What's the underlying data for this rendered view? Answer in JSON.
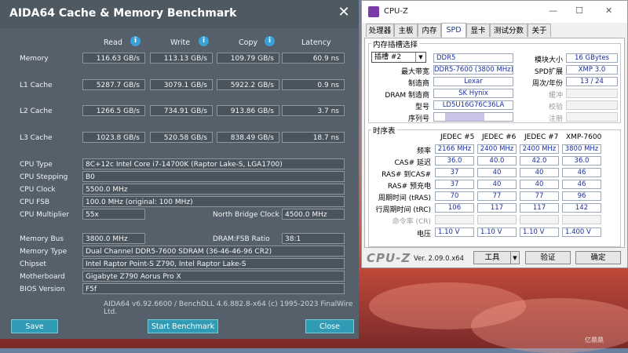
{
  "aida": {
    "title": "AIDA64 Cache & Memory Benchmark",
    "close": "✕",
    "columns": [
      "Read",
      "Write",
      "Copy",
      "Latency"
    ],
    "rows": [
      {
        "label": "Memory",
        "read": "116.63 GB/s",
        "write": "113.13 GB/s",
        "copy": "109.79 GB/s",
        "latency": "60.9 ns"
      },
      {
        "label": "L1 Cache",
        "read": "5287.7 GB/s",
        "write": "3079.1 GB/s",
        "copy": "5922.2 GB/s",
        "latency": "0.9 ns"
      },
      {
        "label": "L2 Cache",
        "read": "1266.5 GB/s",
        "write": "734.91 GB/s",
        "copy": "913.86 GB/s",
        "latency": "3.7 ns"
      },
      {
        "label": "L3 Cache",
        "read": "1023.8 GB/s",
        "write": "520.58 GB/s",
        "copy": "838.49 GB/s",
        "latency": "18.7 ns"
      }
    ],
    "info": {
      "cpu_type_label": "CPU Type",
      "cpu_type": "8C+12c Intel Core i7-14700K  (Raptor Lake-S, LGA1700)",
      "cpu_stepping_label": "CPU Stepping",
      "cpu_stepping": "B0",
      "cpu_clock_label": "CPU Clock",
      "cpu_clock": "5500.0 MHz",
      "cpu_fsb_label": "CPU FSB",
      "cpu_fsb": "100.0 MHz  (original: 100 MHz)",
      "cpu_mult_label": "CPU Multiplier",
      "cpu_mult": "55x",
      "nb_clock_label": "North Bridge Clock",
      "nb_clock": "4500.0 MHz",
      "mem_bus_label": "Memory Bus",
      "mem_bus": "3800.0 MHz",
      "dram_fsb_label": "DRAM:FSB Ratio",
      "dram_fsb": "38:1",
      "mem_type_label": "Memory Type",
      "mem_type": "Dual Channel DDR5-7600 SDRAM  (36-46-46-96 CR2)",
      "chipset_label": "Chipset",
      "chipset": "Intel Raptor Point-S Z790, Intel Raptor Lake-S",
      "mobo_label": "Motherboard",
      "mobo": "Gigabyte Z790 Aorus Pro X",
      "bios_label": "BIOS Version",
      "bios": "F5f"
    },
    "footer": "AIDA64 v6.92.6600 / BenchDLL 4.6.882.8-x64  (c) 1995-2023 FinalWire Ltd.",
    "buttons": {
      "save": "Save",
      "start": "Start Benchmark",
      "close": "Close"
    }
  },
  "cpuz": {
    "title": "CPU-Z",
    "tabs": [
      "处理器",
      "主板",
      "内存",
      "SPD",
      "显卡",
      "测试分数",
      "关于"
    ],
    "slot_group": "内存插槽选择",
    "slot": "插槽 #2",
    "type": "DDR5",
    "module_size_label": "模块大小",
    "module_size": "16 GBytes",
    "max_bw_label": "最大带宽",
    "max_bw": "DDR5-7600 (3800 MHz)",
    "spd_ext_label": "SPD扩展",
    "spd_ext": "XMP 3.0",
    "mfr_label": "制造商",
    "mfr": "Lexar",
    "week_year_label": "周次/年份",
    "week_year": "13 / 24",
    "dram_mfr_label": "DRAM 制造商",
    "dram_mfr": "SK Hynix",
    "buffered_label": "缓冲",
    "model_label": "型号",
    "model": "LD5U16G76C36LA",
    "check_label": "校验",
    "serial_label": "序列号",
    "reg_label": "注册",
    "timing_group": "时序表",
    "timing_cols": [
      "JEDEC #5",
      "JEDEC #6",
      "JEDEC #7",
      "XMP-7600"
    ],
    "timing_rows": [
      {
        "label": "频率",
        "vals": [
          "2166 MHz",
          "2400 MHz",
          "2400 MHz",
          "3800 MHz"
        ]
      },
      {
        "label": "CAS# 延迟",
        "vals": [
          "36.0",
          "40.0",
          "42.0",
          "36.0"
        ]
      },
      {
        "label": "RAS# 到CAS#",
        "vals": [
          "37",
          "40",
          "40",
          "46"
        ]
      },
      {
        "label": "RAS# 预充电",
        "vals": [
          "37",
          "40",
          "40",
          "46"
        ]
      },
      {
        "label": "周期时间 (tRAS)",
        "vals": [
          "70",
          "77",
          "77",
          "96"
        ]
      },
      {
        "label": "行周期时间 (tRC)",
        "vals": [
          "106",
          "117",
          "117",
          "142"
        ]
      },
      {
        "label": "命令率 (CR)",
        "vals": [
          "",
          "",
          "",
          ""
        ]
      },
      {
        "label": "电压",
        "vals": [
          "1.10 V",
          "1.10 V",
          "1.10 V",
          "1.400 V"
        ]
      }
    ],
    "logo": "CPU-Z",
    "version": "Ver. 2.09.0.x64",
    "tools_button": "工具",
    "validate_button": "验证",
    "ok_button": "确定"
  },
  "watermark": "亿鼎鼎"
}
